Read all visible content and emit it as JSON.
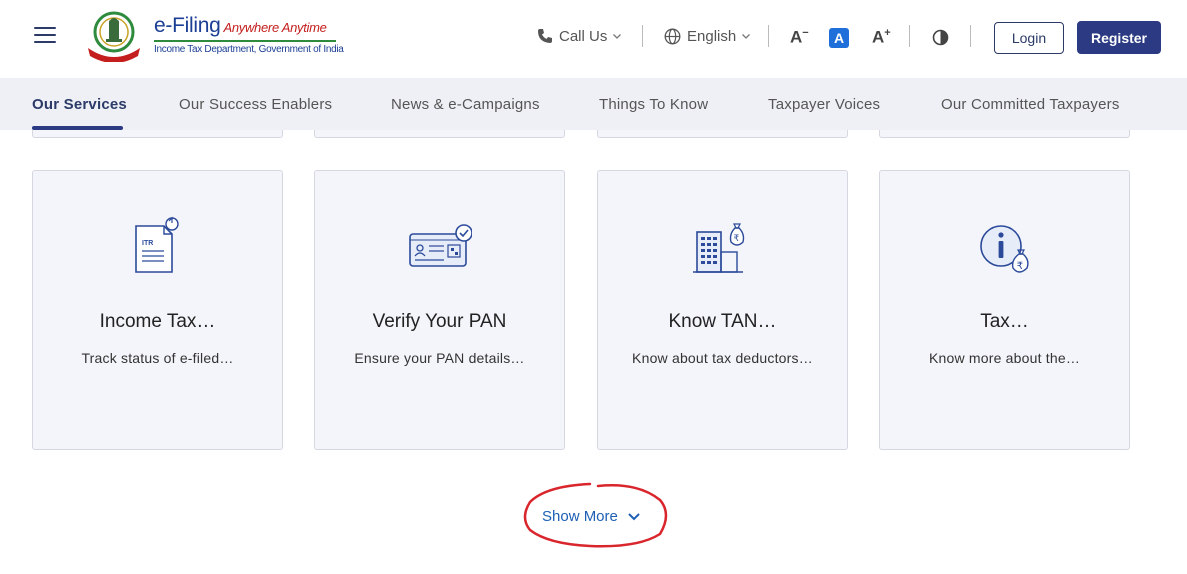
{
  "header": {
    "logo": {
      "title": "e-Filing",
      "tagline": "Anywhere Anytime",
      "subtitle": "Income Tax Department, Government of India"
    },
    "call_us": "Call Us",
    "language": "English",
    "font_decrease": "A",
    "font_default": "A",
    "font_increase": "A",
    "login": "Login",
    "register": "Register"
  },
  "nav": {
    "items": [
      {
        "label": "Our Services",
        "active": true
      },
      {
        "label": "Our Success Enablers"
      },
      {
        "label": "News & e-Campaigns"
      },
      {
        "label": "Things To Know"
      },
      {
        "label": "Taxpayer Voices"
      },
      {
        "label": "Our Committed Taxpayers"
      }
    ]
  },
  "cards": [
    {
      "title": "Income Tax…",
      "description": "Track status of e-filed…",
      "icon": "itr-document-icon"
    },
    {
      "title": "Verify Your PAN",
      "description": "Ensure your PAN details…",
      "icon": "pan-card-verify-icon"
    },
    {
      "title": "Know TAN…",
      "description": "Know about tax deductors…",
      "icon": "building-rupee-icon"
    },
    {
      "title": "Tax…",
      "description": "Know more about the…",
      "icon": "info-rupee-icon"
    }
  ],
  "show_more": "Show More",
  "colors": {
    "primary": "#2b3a83",
    "link": "#1e5fb4",
    "nav_bg": "#eff0f6",
    "card_bg": "#f4f5fa",
    "annotation": "#d9262c"
  }
}
